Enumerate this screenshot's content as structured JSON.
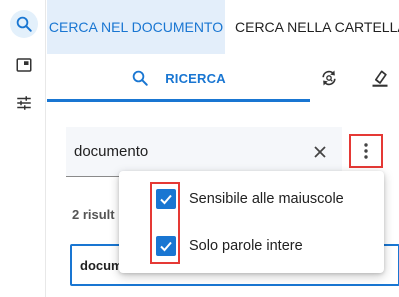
{
  "left_rail": {
    "items": [
      {
        "icon": "search-icon",
        "active": true
      },
      {
        "icon": "panel-icon",
        "active": false
      },
      {
        "icon": "sliders-icon",
        "active": false
      }
    ]
  },
  "tabs": {
    "document": "CERCA NEL DOCUMENTO",
    "folder": "CERCA NELLA CARTELLA"
  },
  "subtabs": {
    "search_label": "RICERCA",
    "search_icon": "search-icon",
    "refresh_icon": "refresh-search-icon",
    "clear_icon": "eraser-icon"
  },
  "search": {
    "value": "documento",
    "clear_icon": "close-icon",
    "more_icon": "more-vertical-icon"
  },
  "results": {
    "count_text": "2 risult",
    "first_item": "documento"
  },
  "menu": {
    "items": [
      {
        "label": "Sensibile alle maiuscole",
        "checked": true
      },
      {
        "label": "Solo parole intere",
        "checked": true
      }
    ]
  },
  "colors": {
    "accent": "#1976d2",
    "highlight": "#e53935",
    "tab_bg": "#e3eefa"
  }
}
